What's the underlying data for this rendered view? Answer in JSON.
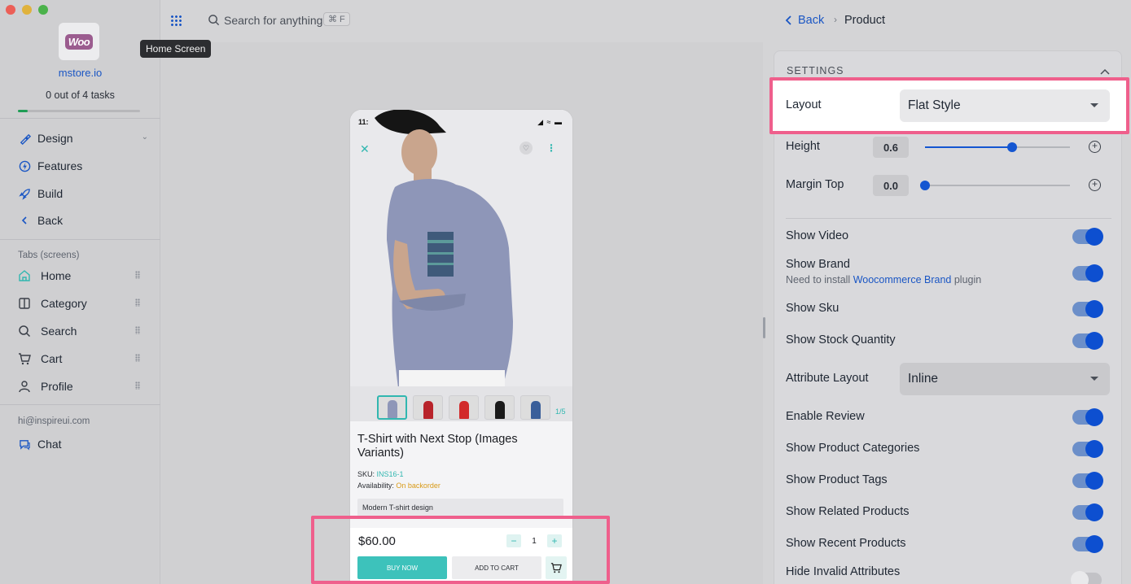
{
  "sidebar": {
    "store_name": "mstore.io",
    "tasks": "0 out of 4 tasks",
    "progress": 0.08,
    "nav": [
      {
        "label": "Design",
        "icon": "brush-icon"
      },
      {
        "label": "Features",
        "icon": "bolt-icon"
      },
      {
        "label": "Build",
        "icon": "rocket-icon"
      },
      {
        "label": "Back",
        "icon": "chevron-left-icon"
      }
    ],
    "tabs_label": "Tabs (screens)",
    "tabs": [
      {
        "label": "Home",
        "icon": "home-icon"
      },
      {
        "label": "Category",
        "icon": "columns-icon"
      },
      {
        "label": "Search",
        "icon": "search-icon"
      },
      {
        "label": "Cart",
        "icon": "cart-icon"
      },
      {
        "label": "Profile",
        "icon": "user-icon"
      }
    ],
    "email": "hi@inspireui.com",
    "chat": "Chat"
  },
  "topbar": {
    "search_placeholder": "Search for anything",
    "shortcut": "⌘ F",
    "tooltip": "Home Screen"
  },
  "preview": {
    "time": "11:",
    "image_count": "1/5",
    "title": "T-Shirt with Next Stop (Images Variants)",
    "sku_label": "SKU:",
    "sku": "INS16-1",
    "availability_label": "Availability:",
    "availability": "On backorder",
    "description": "Modern T-shirt design",
    "price": "$60.00",
    "qty": "1",
    "buy_now": "BUY NOW",
    "add_to_cart": "ADD TO CART"
  },
  "header": {
    "back": "Back",
    "current": "Product"
  },
  "settings": {
    "section": "SETTINGS",
    "layout_label": "Layout",
    "layout_value": "Flat Style",
    "height_label": "Height",
    "height_value": "0.6",
    "height_fraction": 0.6,
    "margin_label": "Margin Top",
    "margin_value": "0.0",
    "toggles": [
      {
        "label": "Show Video",
        "on": true
      },
      {
        "label": "Show Brand",
        "on": true
      },
      {
        "label": "Show Sku",
        "on": true
      },
      {
        "label": "Show Stock Quantity",
        "on": true
      },
      {
        "label": "Enable Review",
        "on": true
      },
      {
        "label": "Show Product Categories",
        "on": true
      },
      {
        "label": "Show Product Tags",
        "on": true
      },
      {
        "label": "Show Related Products",
        "on": true
      },
      {
        "label": "Show Recent Products",
        "on": true
      },
      {
        "label": "Hide Invalid Attributes",
        "on": false
      }
    ],
    "brand_note_pre": "Need to install",
    "brand_note_link": "Woocommerce Brand",
    "brand_note_post": "plugin",
    "attribute_layout_label": "Attribute Layout",
    "attribute_layout_value": "Inline"
  },
  "colors": {
    "accent": "#1a56c4",
    "teal": "#31b7b0",
    "highlight": "#ef5f8c"
  }
}
